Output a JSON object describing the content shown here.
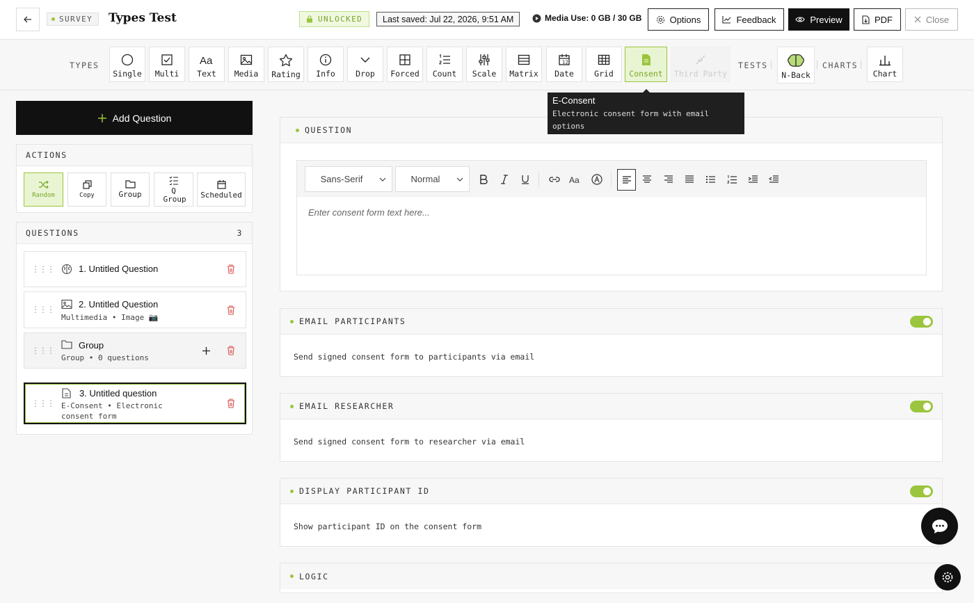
{
  "header": {
    "survey_badge": "SURVEY",
    "title": "Types Test",
    "unlocked": "UNLOCKED",
    "last_saved": "Last saved: Jul 22, 2026, 9:51 AM",
    "media_use": "Media Use: 0 GB / 30 GB",
    "buttons": {
      "options": "Options",
      "feedback": "Feedback",
      "preview": "Preview",
      "pdf": "PDF",
      "close": "Close"
    }
  },
  "toolbar": {
    "types_label": "TYPES",
    "tests_label": "TESTS",
    "charts_label": "CHARTS",
    "types": [
      {
        "label": "Single",
        "icon": "circle-icon"
      },
      {
        "label": "Multi",
        "icon": "checkbox-icon"
      },
      {
        "label": "Text",
        "icon": "text-aa-icon"
      },
      {
        "label": "Media",
        "icon": "image-icon"
      },
      {
        "label": "Rating",
        "icon": "star-icon"
      },
      {
        "label": "Info",
        "icon": "info-icon"
      },
      {
        "label": "Drop",
        "icon": "chevron-down-icon"
      },
      {
        "label": "Forced",
        "icon": "grid-icon"
      },
      {
        "label": "Count",
        "icon": "numbered-list-icon"
      },
      {
        "label": "Scale",
        "icon": "sliders-icon"
      },
      {
        "label": "Matrix",
        "icon": "table-icon"
      },
      {
        "label": "Date",
        "icon": "calendar-icon"
      },
      {
        "label": "Grid",
        "icon": "grid-table-icon"
      },
      {
        "label": "Consent",
        "icon": "document-icon"
      },
      {
        "label": "Third Party",
        "icon": "plug-icon"
      }
    ],
    "tests": [
      {
        "label": "N-Back",
        "icon": "brain-icon"
      }
    ],
    "charts": [
      {
        "label": "Chart",
        "icon": "bar-chart-icon"
      }
    ],
    "tooltip": {
      "title": "E-Consent",
      "description": "Electronic consent form with email options"
    }
  },
  "sidebar": {
    "add_question": "Add Question",
    "actions_title": "ACTIONS",
    "actions": [
      {
        "label": "Random"
      },
      {
        "label": "Copy"
      },
      {
        "label": "Group"
      },
      {
        "label": "Q Group"
      },
      {
        "label": "Scheduled"
      }
    ],
    "questions_title": "QUESTIONS",
    "questions_count": "3",
    "questions": [
      {
        "title": "1. Untitled Question",
        "subtitle": ""
      },
      {
        "title": "2. Untitled Question",
        "subtitle": "Multimedia • Image 📷"
      },
      {
        "title": "Group",
        "subtitle": "Group • 0 questions"
      },
      {
        "title": "3. Untitled question",
        "subtitle": "E-Consent • Electronic consent form"
      }
    ]
  },
  "main": {
    "question_title": "QUESTION",
    "editor": {
      "font": "Sans-Serif",
      "size": "Normal",
      "placeholder": "Enter consent form text here..."
    },
    "sections": [
      {
        "title": "EMAIL PARTICIPANTS",
        "text": "Send signed consent form to participants via email",
        "enabled": true
      },
      {
        "title": "EMAIL RESEARCHER",
        "text": "Send signed consent form to researcher via email",
        "enabled": true
      },
      {
        "title": "DISPLAY PARTICIPANT ID",
        "text": "Show participant ID on the consent form",
        "enabled": true
      }
    ],
    "logic_title": "LOGIC"
  },
  "colors": {
    "accent": "#9bc53d",
    "accent_bg": "#e9f5d2",
    "dark": "#111111",
    "danger": "#d9534f"
  }
}
